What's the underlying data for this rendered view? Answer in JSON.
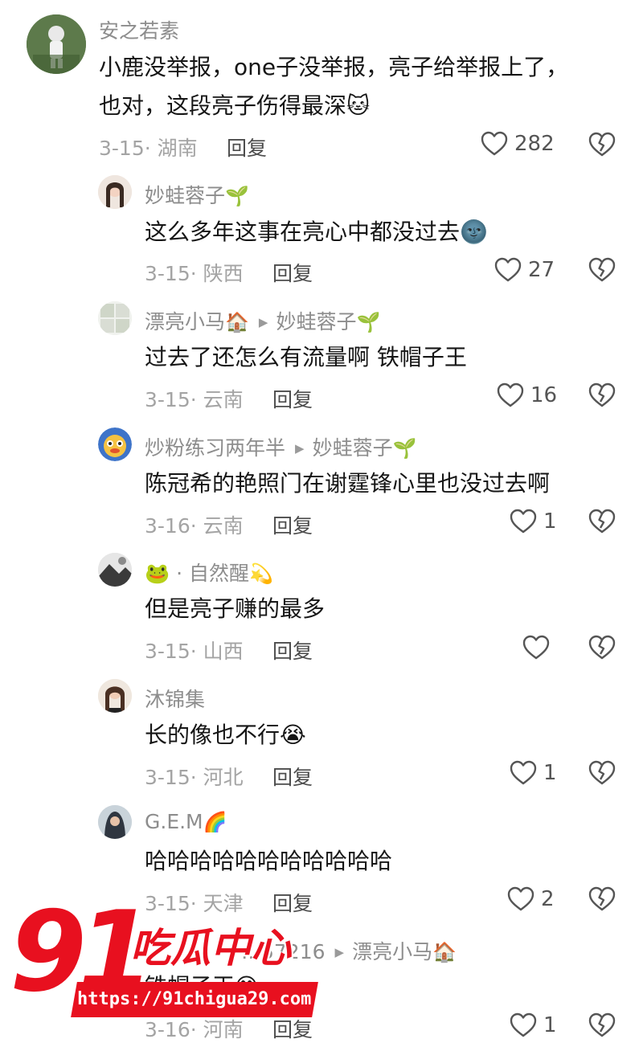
{
  "comments": [
    {
      "name": "安之若素",
      "name_emoji": "",
      "reply_to": "",
      "reply_to_emoji": "",
      "lines": [
        "小鹿没举报，one子没举报，亮子给举报上了，",
        "也对，这段亮子伤得最深🐱"
      ],
      "date_location": "3-15· 湖南",
      "reply_label": "回复",
      "likes": "282"
    },
    {
      "name": "妙蛙蓉子",
      "name_emoji": "🌱",
      "reply_to": "",
      "reply_to_emoji": "",
      "lines": [
        "这么多年这事在亮心中都没过去🌚"
      ],
      "date_location": "3-15· 陕西",
      "reply_label": "回复",
      "likes": "27"
    },
    {
      "name": "漂亮小马",
      "name_emoji": "🏠",
      "reply_to": "妙蛙蓉子",
      "reply_to_emoji": "🌱",
      "lines": [
        "过去了还怎么有流量啊 铁帽子王"
      ],
      "date_location": "3-15· 云南",
      "reply_label": "回复",
      "likes": "16"
    },
    {
      "name": "炒粉练习两年半",
      "name_emoji": "",
      "reply_to": "妙蛙蓉子",
      "reply_to_emoji": "🌱",
      "lines": [
        "陈冠希的艳照门在谢霆锋心里也没过去啊"
      ],
      "date_location": "3-16· 云南",
      "reply_label": "回复",
      "likes": "1"
    },
    {
      "name": "🐸 · 自然醒",
      "name_emoji": "💫",
      "reply_to": "",
      "reply_to_emoji": "",
      "lines": [
        "但是亮子赚的最多"
      ],
      "date_location": "3-15· 山西",
      "reply_label": "回复",
      "likes": ""
    },
    {
      "name": "沐锦集",
      "name_emoji": "",
      "reply_to": "",
      "reply_to_emoji": "",
      "lines": [
        "长的像也不行😭"
      ],
      "date_location": "3-15· 河北",
      "reply_label": "回复",
      "likes": "1"
    },
    {
      "name": "G.E.M",
      "name_emoji": "🌈",
      "reply_to": "",
      "reply_to_emoji": "",
      "lines": [
        "哈哈哈哈哈哈哈哈哈哈哈"
      ],
      "date_location": "3-15· 天津",
      "reply_label": "回复",
      "likes": "2"
    },
    {
      "name": "…57216",
      "name_emoji": "",
      "reply_to": "漂亮小马",
      "reply_to_emoji": "🏠",
      "lines": [
        "铁帽子王😅"
      ],
      "date_location": "3-16· 河南",
      "reply_label": "回复",
      "likes": "1"
    }
  ],
  "watermark": {
    "number": "91",
    "chinese": "吃瓜中心",
    "url": "https://91chigua29.com"
  },
  "icons": {
    "like": "heart-outline-icon",
    "dislike": "broken-heart-icon"
  },
  "colors": {
    "username": "#8d8d8d",
    "text": "#161616",
    "meta": "#a4a4a4",
    "watermark": "#e8101f"
  }
}
